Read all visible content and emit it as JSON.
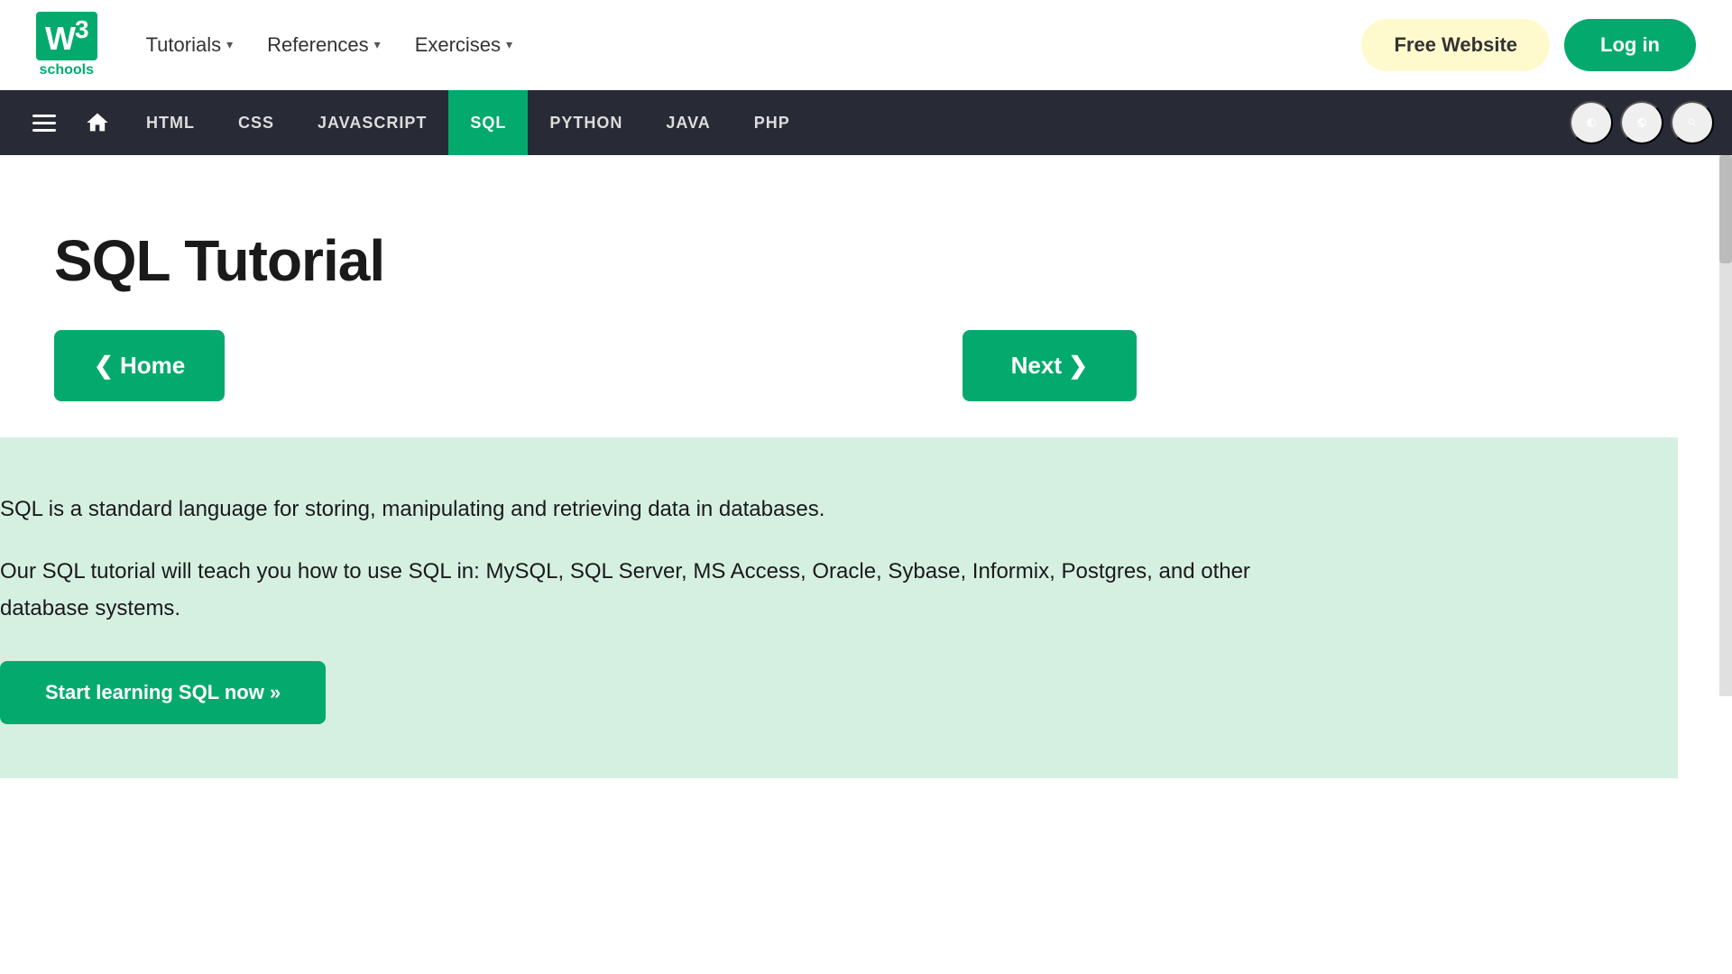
{
  "logo": {
    "w3_text": "W",
    "superscript": "3",
    "schools_text": "schools"
  },
  "top_nav": {
    "menu_items": [
      {
        "label": "Tutorials",
        "id": "tutorials"
      },
      {
        "label": "References",
        "id": "references"
      },
      {
        "label": "Exercises",
        "id": "exercises"
      }
    ],
    "btn_free_website": "Free Website",
    "btn_login": "Log in"
  },
  "secondary_nav": {
    "links": [
      {
        "label": "HTML",
        "id": "html",
        "active": false
      },
      {
        "label": "CSS",
        "id": "css",
        "active": false
      },
      {
        "label": "JAVASCRIPT",
        "id": "javascript",
        "active": false
      },
      {
        "label": "SQL",
        "id": "sql",
        "active": true
      },
      {
        "label": "PYTHON",
        "id": "python",
        "active": false
      },
      {
        "label": "JAVA",
        "id": "java",
        "active": false
      },
      {
        "label": "PHP",
        "id": "php",
        "active": false
      }
    ]
  },
  "main": {
    "page_title": "SQL Tutorial",
    "btn_home_label": "❮ Home",
    "btn_next_label": "Next ❯",
    "info_line1": "SQL is a standard language for storing, manipulating and retrieving data in databases.",
    "info_line2": "Our SQL tutorial will teach you how to use SQL in: MySQL, SQL Server, MS Access, Oracle, Sybase, Informix, Postgres, and other database systems.",
    "btn_start_learning": "Start learning SQL now »"
  }
}
